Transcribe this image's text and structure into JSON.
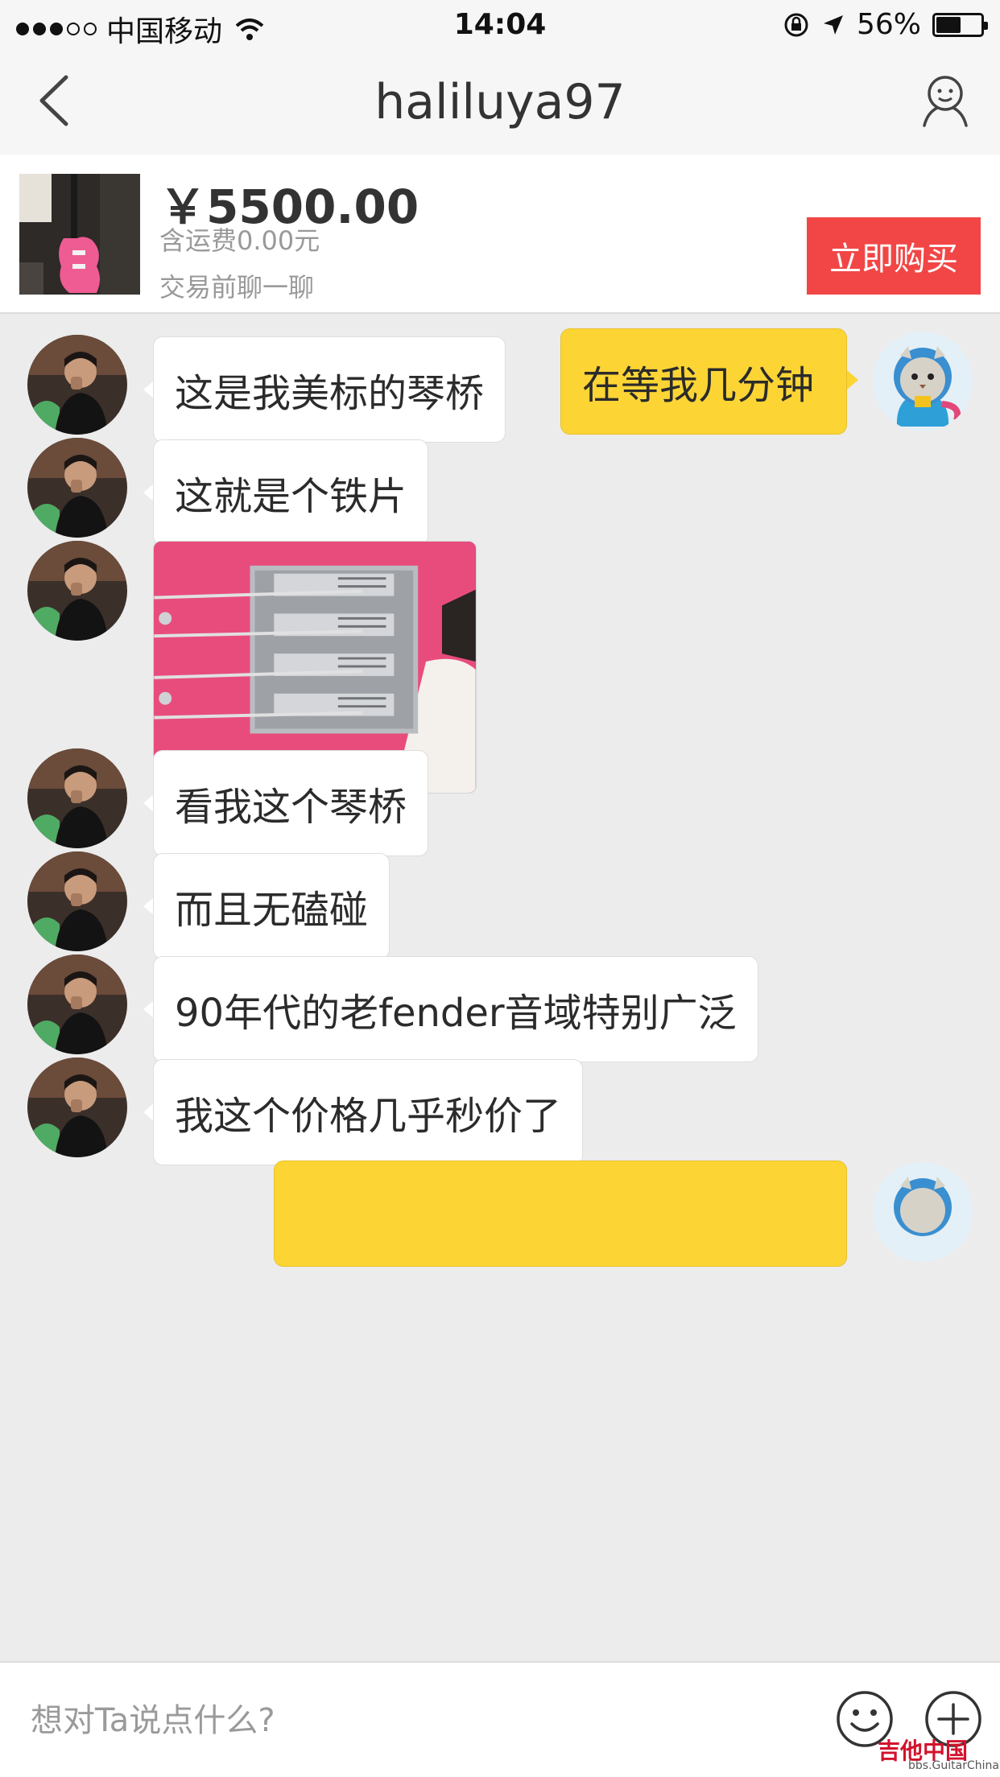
{
  "status_bar": {
    "carrier": "中国移动",
    "time": "14:04",
    "battery": "56%"
  },
  "nav": {
    "title": "haliluya97"
  },
  "product": {
    "price": "￥5500.00",
    "shipping": "含运费0.00元",
    "chat_note": "交易前聊一聊",
    "buy_label": "立即购买"
  },
  "messages": [
    {
      "sender": "me",
      "text": "在等我几分钟"
    },
    {
      "sender": "other",
      "text": "这是我美标的琴桥"
    },
    {
      "sender": "other",
      "text": "这就是个铁片"
    },
    {
      "sender": "other",
      "type": "image"
    },
    {
      "sender": "other",
      "text": "看我这个琴桥"
    },
    {
      "sender": "other",
      "text": "而且无磕碰"
    },
    {
      "sender": "other",
      "text": "90年代的老fender音域特别广泛"
    },
    {
      "sender": "other",
      "text": "我这个价格几乎秒价了"
    },
    {
      "sender": "me",
      "text": ""
    }
  ],
  "input": {
    "placeholder": "想对Ta说点什么?"
  },
  "watermark": {
    "brand": "吉他中国",
    "url": "bbs.GuitarChina.com"
  },
  "colors": {
    "my_bubble": "#fcd535",
    "buy_button": "#f24646",
    "background": "#ececec"
  },
  "icons": [
    "back-chevron-icon",
    "user-profile-icon",
    "emoji-icon",
    "plus-icon",
    "wifi-icon",
    "location-arrow-icon",
    "orientation-lock-icon"
  ]
}
